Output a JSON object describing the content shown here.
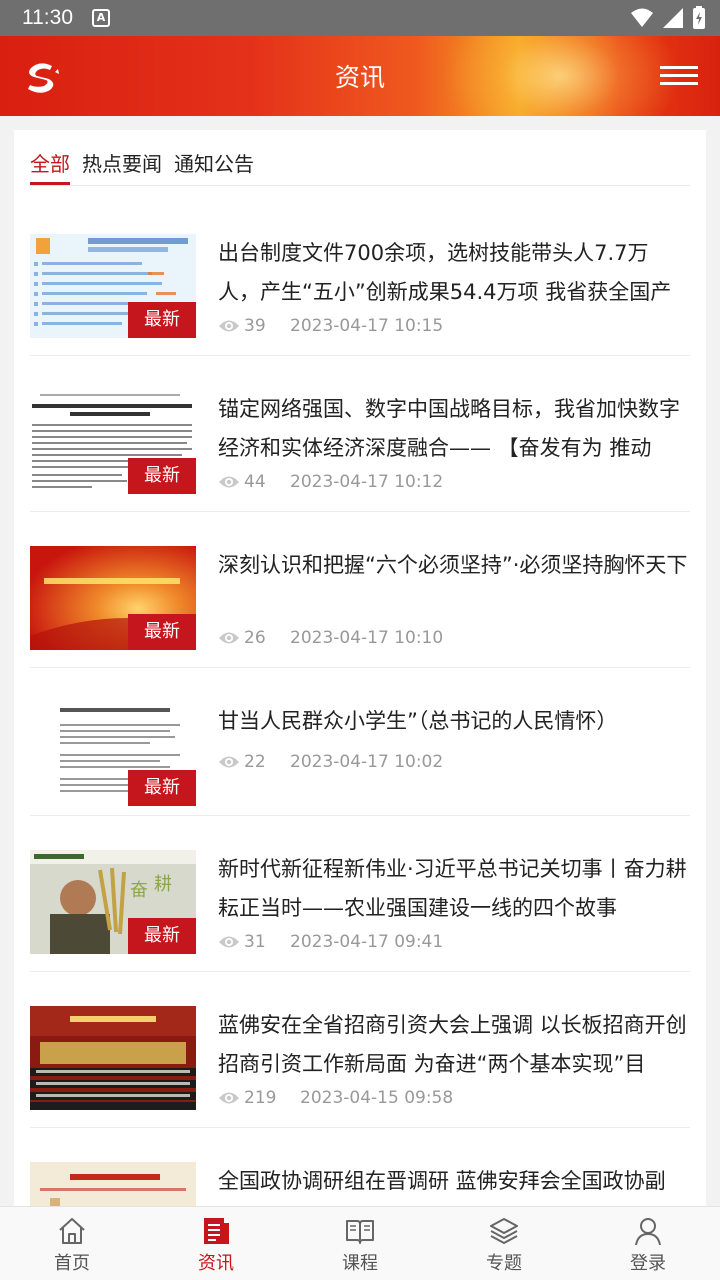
{
  "status_bar": {
    "time": "11:30",
    "notification_label": "A"
  },
  "header": {
    "title": "资讯"
  },
  "tabs": [
    {
      "label": "全部",
      "active": true
    },
    {
      "label": "热点要闻",
      "active": false
    },
    {
      "label": "通知公告",
      "active": false
    }
  ],
  "badge_label": "最新",
  "news": [
    {
      "title": "出台制度文件700余项，选树技能带头人7.7万人，产生“五小”创新成果54.4万项 我省获全国产",
      "views": "39",
      "date": "2023-04-17 10:15",
      "thumb_text": "我省出台相关政策制度文件700余项"
    },
    {
      "title": "锚定网络强国、数字中国战略目标，我省加快数字经济和实体经济深度融合—— 【奋发有为 推动",
      "views": "44",
      "date": "2023-04-17 10:12",
      "thumb_text": "【奋发有为 推动高质量发展】数字化助力“产业链、专业链”双链学加速运行"
    },
    {
      "title": "深刻认识和把握“六个必须坚持”·必须坚持胸怀天下",
      "views": "26",
      "date": "2023-04-17 10:10",
      "thumb_text": "深刻认识和把握“六个必须坚持”·必须坚持胸怀天下"
    },
    {
      "title": "甘当人民群众小学生”（总书记的人民情怀）",
      "views": "22",
      "date": "2023-04-17 10:02",
      "thumb_text": "“甘当人民群众小学生”（总书记的人民情怀）"
    },
    {
      "title": "新时代新征程新伟业·习近平总书记关切事丨奋力耕耘正当时——农业强国建设一线的四个故事",
      "views": "31",
      "date": "2023-04-17 09:41",
      "thumb_text": "奋力耕耘"
    },
    {
      "title": "蓝佛安在全省招商引资大会上强调 以长板招商开创招商引资工作新局面 为奋进“两个基本实现”目",
      "views": "219",
      "date": "2023-04-15 09:58",
      "thumb_text": "全省招商引资大会"
    },
    {
      "title": "全国政协调研组在晋调研 蓝佛安拜会全国政协副",
      "views": "",
      "date": "",
      "thumb_text": "全国政协调研组在晋调研"
    }
  ],
  "bottom_nav": [
    {
      "label": "首页",
      "icon": "home-icon",
      "active": false
    },
    {
      "label": "资讯",
      "icon": "news-icon",
      "active": true
    },
    {
      "label": "课程",
      "icon": "book-icon",
      "active": false
    },
    {
      "label": "专题",
      "icon": "layers-icon",
      "active": false
    },
    {
      "label": "登录",
      "icon": "user-icon",
      "active": false
    }
  ],
  "colors": {
    "accent": "#c4161c",
    "header_red": "#d91f10",
    "header_gold": "#f5a21f"
  }
}
